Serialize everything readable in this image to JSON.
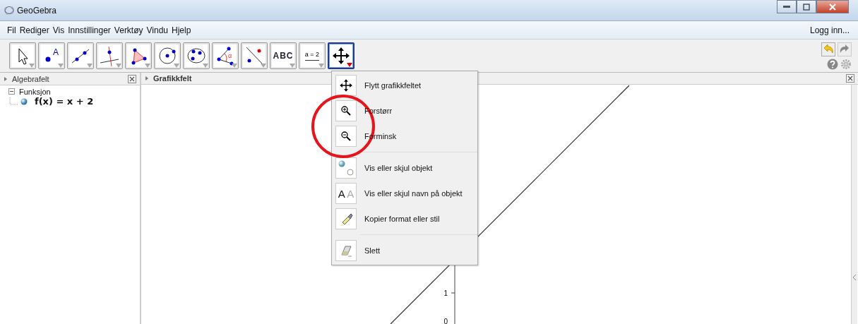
{
  "window": {
    "title": "GeoGebra"
  },
  "menu_bar": {
    "items": [
      "Fil",
      "Rediger",
      "Vis",
      "Innstillinger",
      "Verktøy",
      "Vindu",
      "Hjelp"
    ],
    "login": "Logg inn..."
  },
  "toolbar": {
    "tools": [
      {
        "kind": "move",
        "selected": false
      },
      {
        "kind": "point",
        "label": "A",
        "selected": false
      },
      {
        "kind": "line",
        "selected": false
      },
      {
        "kind": "perpendicular",
        "selected": false
      },
      {
        "kind": "polygon",
        "selected": false
      },
      {
        "kind": "circle",
        "selected": false
      },
      {
        "kind": "ellipse",
        "selected": false
      },
      {
        "kind": "angle",
        "label": "α",
        "selected": false
      },
      {
        "kind": "reflect",
        "selected": false
      },
      {
        "kind": "text",
        "label": "ABC",
        "selected": false
      },
      {
        "kind": "slider",
        "label": "a = 2",
        "selected": false
      },
      {
        "kind": "pan",
        "selected": true
      }
    ]
  },
  "algebra_view": {
    "title": "Algebrafelt",
    "groups": [
      {
        "label": "Funksjon",
        "expanded": true,
        "children": [
          {
            "label": "f(x) = x + 2"
          }
        ]
      }
    ]
  },
  "graphics_view": {
    "title": "Grafikkfelt",
    "y_tick_labels": [
      "1",
      "0"
    ]
  },
  "tool_menu": {
    "groups": [
      {
        "items": [
          {
            "kind": "pan",
            "label": "Flytt grafikkfeltet"
          },
          {
            "kind": "zoom_in",
            "label": "Forstørr"
          },
          {
            "kind": "zoom_out",
            "label": "Forminsk"
          }
        ]
      },
      {
        "items": [
          {
            "kind": "show_hide",
            "label": "Vis eller skjul objekt"
          },
          {
            "kind": "show_label",
            "icon_text": [
              "A",
              "A"
            ],
            "label": "Vis eller skjul navn på objekt"
          },
          {
            "kind": "copy_style",
            "label": "Kopier format eller stil"
          }
        ]
      },
      {
        "items": [
          {
            "kind": "delete",
            "label": "Slett"
          }
        ]
      }
    ]
  }
}
